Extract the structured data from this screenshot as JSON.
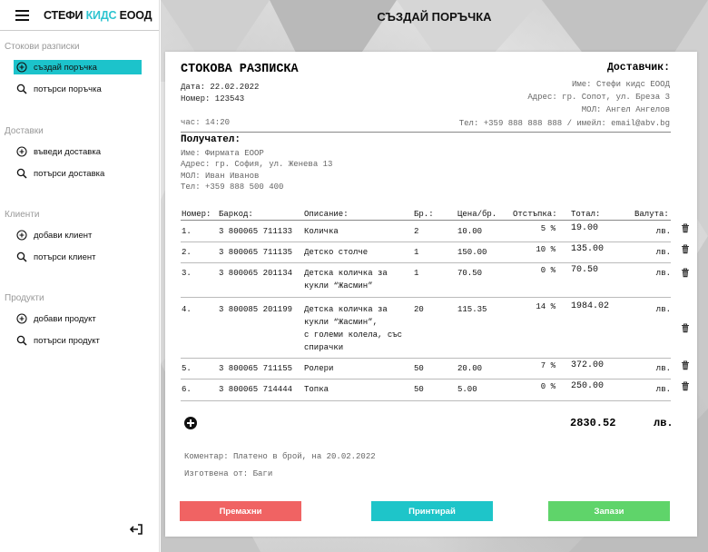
{
  "brand": {
    "name_part1": "СТЕФИ ",
    "name_accent": "КИДС",
    "name_part2": " ЕООД",
    "accent_color": "#2ec4d0"
  },
  "sidebar": {
    "sections": [
      {
        "title": "Стокови разписки",
        "items": [
          {
            "label": "създай поръчка",
            "icon": "plus-circle-icon",
            "active": true
          },
          {
            "label": "потърси поръчка",
            "icon": "search-icon"
          }
        ]
      },
      {
        "title": "Доставки",
        "items": [
          {
            "label": "въведи доставка",
            "icon": "plus-circle-icon"
          },
          {
            "label": "потърси доставка",
            "icon": "search-icon"
          }
        ]
      },
      {
        "title": "Клиенти",
        "items": [
          {
            "label": "добави клиент",
            "icon": "plus-circle-icon"
          },
          {
            "label": "потърси клиент",
            "icon": "search-icon"
          }
        ]
      },
      {
        "title": "Продукти",
        "items": [
          {
            "label": "добави продукт",
            "icon": "plus-circle-icon"
          },
          {
            "label": "потърси продукт",
            "icon": "search-icon"
          }
        ]
      }
    ],
    "active_color": "#1cc3cb",
    "logout_icon": "logout-icon"
  },
  "header": {
    "title": "СЪЗДАЙ ПОРЪЧКА"
  },
  "document": {
    "title": "СТОКОВА РАЗПИСКА",
    "date": "Дата: 22.02.2022",
    "number": "Номер: 123543",
    "time": "час: 14:20",
    "supplier": {
      "label": "Доставчик:",
      "name": "Име: Стефи кидс ЕООД",
      "address": "Адрес: гр. Сопот, ул. Бреза 3",
      "mol": "МОЛ: Ангел Ангелов",
      "contact": "Тел: +359 888 888 888 / имейл: email@abv.bg"
    },
    "recipient": {
      "label": "Получател:",
      "name": "Име: Фирмата ЕООР",
      "address": "Адрес: гр. София, ул. Женева 13",
      "mol": "МОЛ: Иван Иванов",
      "phone": "Тел: +359 888 500 400"
    }
  },
  "table": {
    "headers": [
      "Номер:",
      "Баркод:",
      "Описание:",
      "Бр.:",
      "Цена/бр.",
      "Отстъпка:",
      "Тотал:",
      "Валута:"
    ],
    "rows": [
      {
        "num": "1.",
        "barcode": "3 800065 711133",
        "description": [
          "Количка"
        ],
        "qty": "2",
        "price": "10.00",
        "discount": "5 %",
        "total": "19.00",
        "currency": "лв."
      },
      {
        "num": "2.",
        "barcode": "3 800065 711135",
        "description": [
          "Детско столче"
        ],
        "qty": "1",
        "price": "150.00",
        "discount": "10 %",
        "total": "135.00",
        "currency": "лв."
      },
      {
        "num": "3.",
        "barcode": "3 800065 201134",
        "description": [
          "Детска количка за",
          "кукли “Жасмин”"
        ],
        "qty": "1",
        "price": "70.50",
        "discount": "0 %",
        "total": "70.50",
        "currency": "лв."
      },
      {
        "num": "4.",
        "barcode": "3 800085 201199",
        "description": [
          "Детска количка за",
          "кукли “Жасмин”,",
          "с големи колела, със",
          "спирачки"
        ],
        "qty": "20",
        "price": "115.35",
        "discount": "14 %",
        "total": "1984.02",
        "currency": "лв."
      },
      {
        "num": "5.",
        "barcode": "3 800065 711155",
        "description": [
          "Ролери"
        ],
        "qty": "50",
        "price": "20.00",
        "discount": "7 %",
        "total": "372.00",
        "currency": "лв."
      },
      {
        "num": "6.",
        "barcode": "3 800065 714444",
        "description": [
          "Топка"
        ],
        "qty": "50",
        "price": "5.00",
        "discount": "0 %",
        "total": "250.00",
        "currency": "лв."
      }
    ]
  },
  "summary": {
    "total": "2830.52",
    "currency": "лв."
  },
  "comment": "Коментар: Платено в брой, на 20.02.2022",
  "prepared_by": "Изготвена от: Баги",
  "buttons": {
    "remove": {
      "label": "Премахни",
      "color": "#f06363"
    },
    "print": {
      "label": "Принтирай",
      "color": "#1ec5c9"
    },
    "save": {
      "label": "Запази",
      "color": "#5fd46a"
    }
  }
}
